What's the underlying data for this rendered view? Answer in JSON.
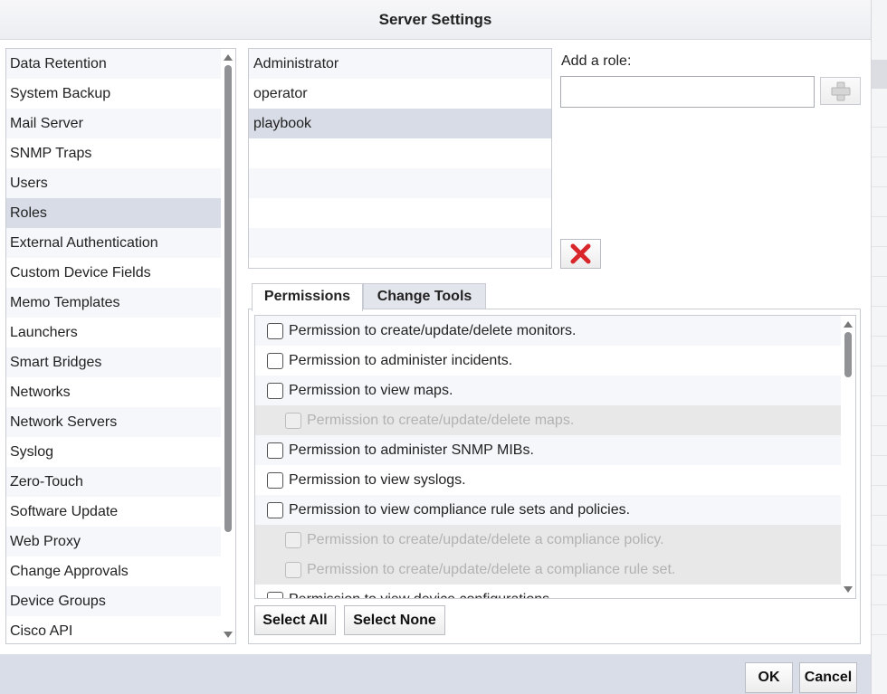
{
  "dialog": {
    "title": "Server Settings"
  },
  "sidebar": {
    "items": [
      {
        "label": "Data Retention"
      },
      {
        "label": "System Backup"
      },
      {
        "label": "Mail Server"
      },
      {
        "label": "SNMP Traps"
      },
      {
        "label": "Users"
      },
      {
        "label": "Roles",
        "selected": true
      },
      {
        "label": "External Authentication"
      },
      {
        "label": "Custom Device Fields"
      },
      {
        "label": "Memo Templates"
      },
      {
        "label": "Launchers"
      },
      {
        "label": "Smart Bridges"
      },
      {
        "label": "Networks"
      },
      {
        "label": "Network Servers"
      },
      {
        "label": "Syslog"
      },
      {
        "label": "Zero-Touch"
      },
      {
        "label": "Software Update"
      },
      {
        "label": "Web Proxy"
      },
      {
        "label": "Change Approvals"
      },
      {
        "label": "Device Groups"
      },
      {
        "label": "Cisco API"
      }
    ]
  },
  "roles": {
    "items": [
      {
        "label": "Administrator"
      },
      {
        "label": "operator"
      },
      {
        "label": "playbook",
        "selected": true
      }
    ],
    "add_label": "Add a role:",
    "add_value": "",
    "add_button_icon": "plus-icon",
    "delete_button_icon": "red-x-icon"
  },
  "tabs": [
    {
      "label": "Permissions",
      "active": true
    },
    {
      "label": "Change Tools",
      "active": false
    }
  ],
  "permissions": [
    {
      "label": "Permission to create/update/delete monitors.",
      "checked": false,
      "disabled": false
    },
    {
      "label": "Permission to administer incidents.",
      "checked": false,
      "disabled": false
    },
    {
      "label": "Permission to view maps.",
      "checked": false,
      "disabled": false
    },
    {
      "label": "Permission to create/update/delete maps.",
      "checked": false,
      "disabled": true
    },
    {
      "label": "Permission to administer SNMP MIBs.",
      "checked": false,
      "disabled": false
    },
    {
      "label": "Permission to view syslogs.",
      "checked": false,
      "disabled": false
    },
    {
      "label": "Permission to view compliance rule sets and policies.",
      "checked": false,
      "disabled": false
    },
    {
      "label": "Permission to create/update/delete a compliance policy.",
      "checked": false,
      "disabled": true
    },
    {
      "label": "Permission to create/update/delete a compliance rule set.",
      "checked": false,
      "disabled": true
    },
    {
      "label": "Permission to view device configurations.",
      "checked": false,
      "disabled": false
    }
  ],
  "buttons": {
    "select_all": "Select All",
    "select_none": "Select None",
    "ok": "OK",
    "cancel": "Cancel"
  },
  "colors": {
    "selected_row": "#d8dce6",
    "footer": "#d9dde8",
    "delete_icon": "#d8262b"
  }
}
